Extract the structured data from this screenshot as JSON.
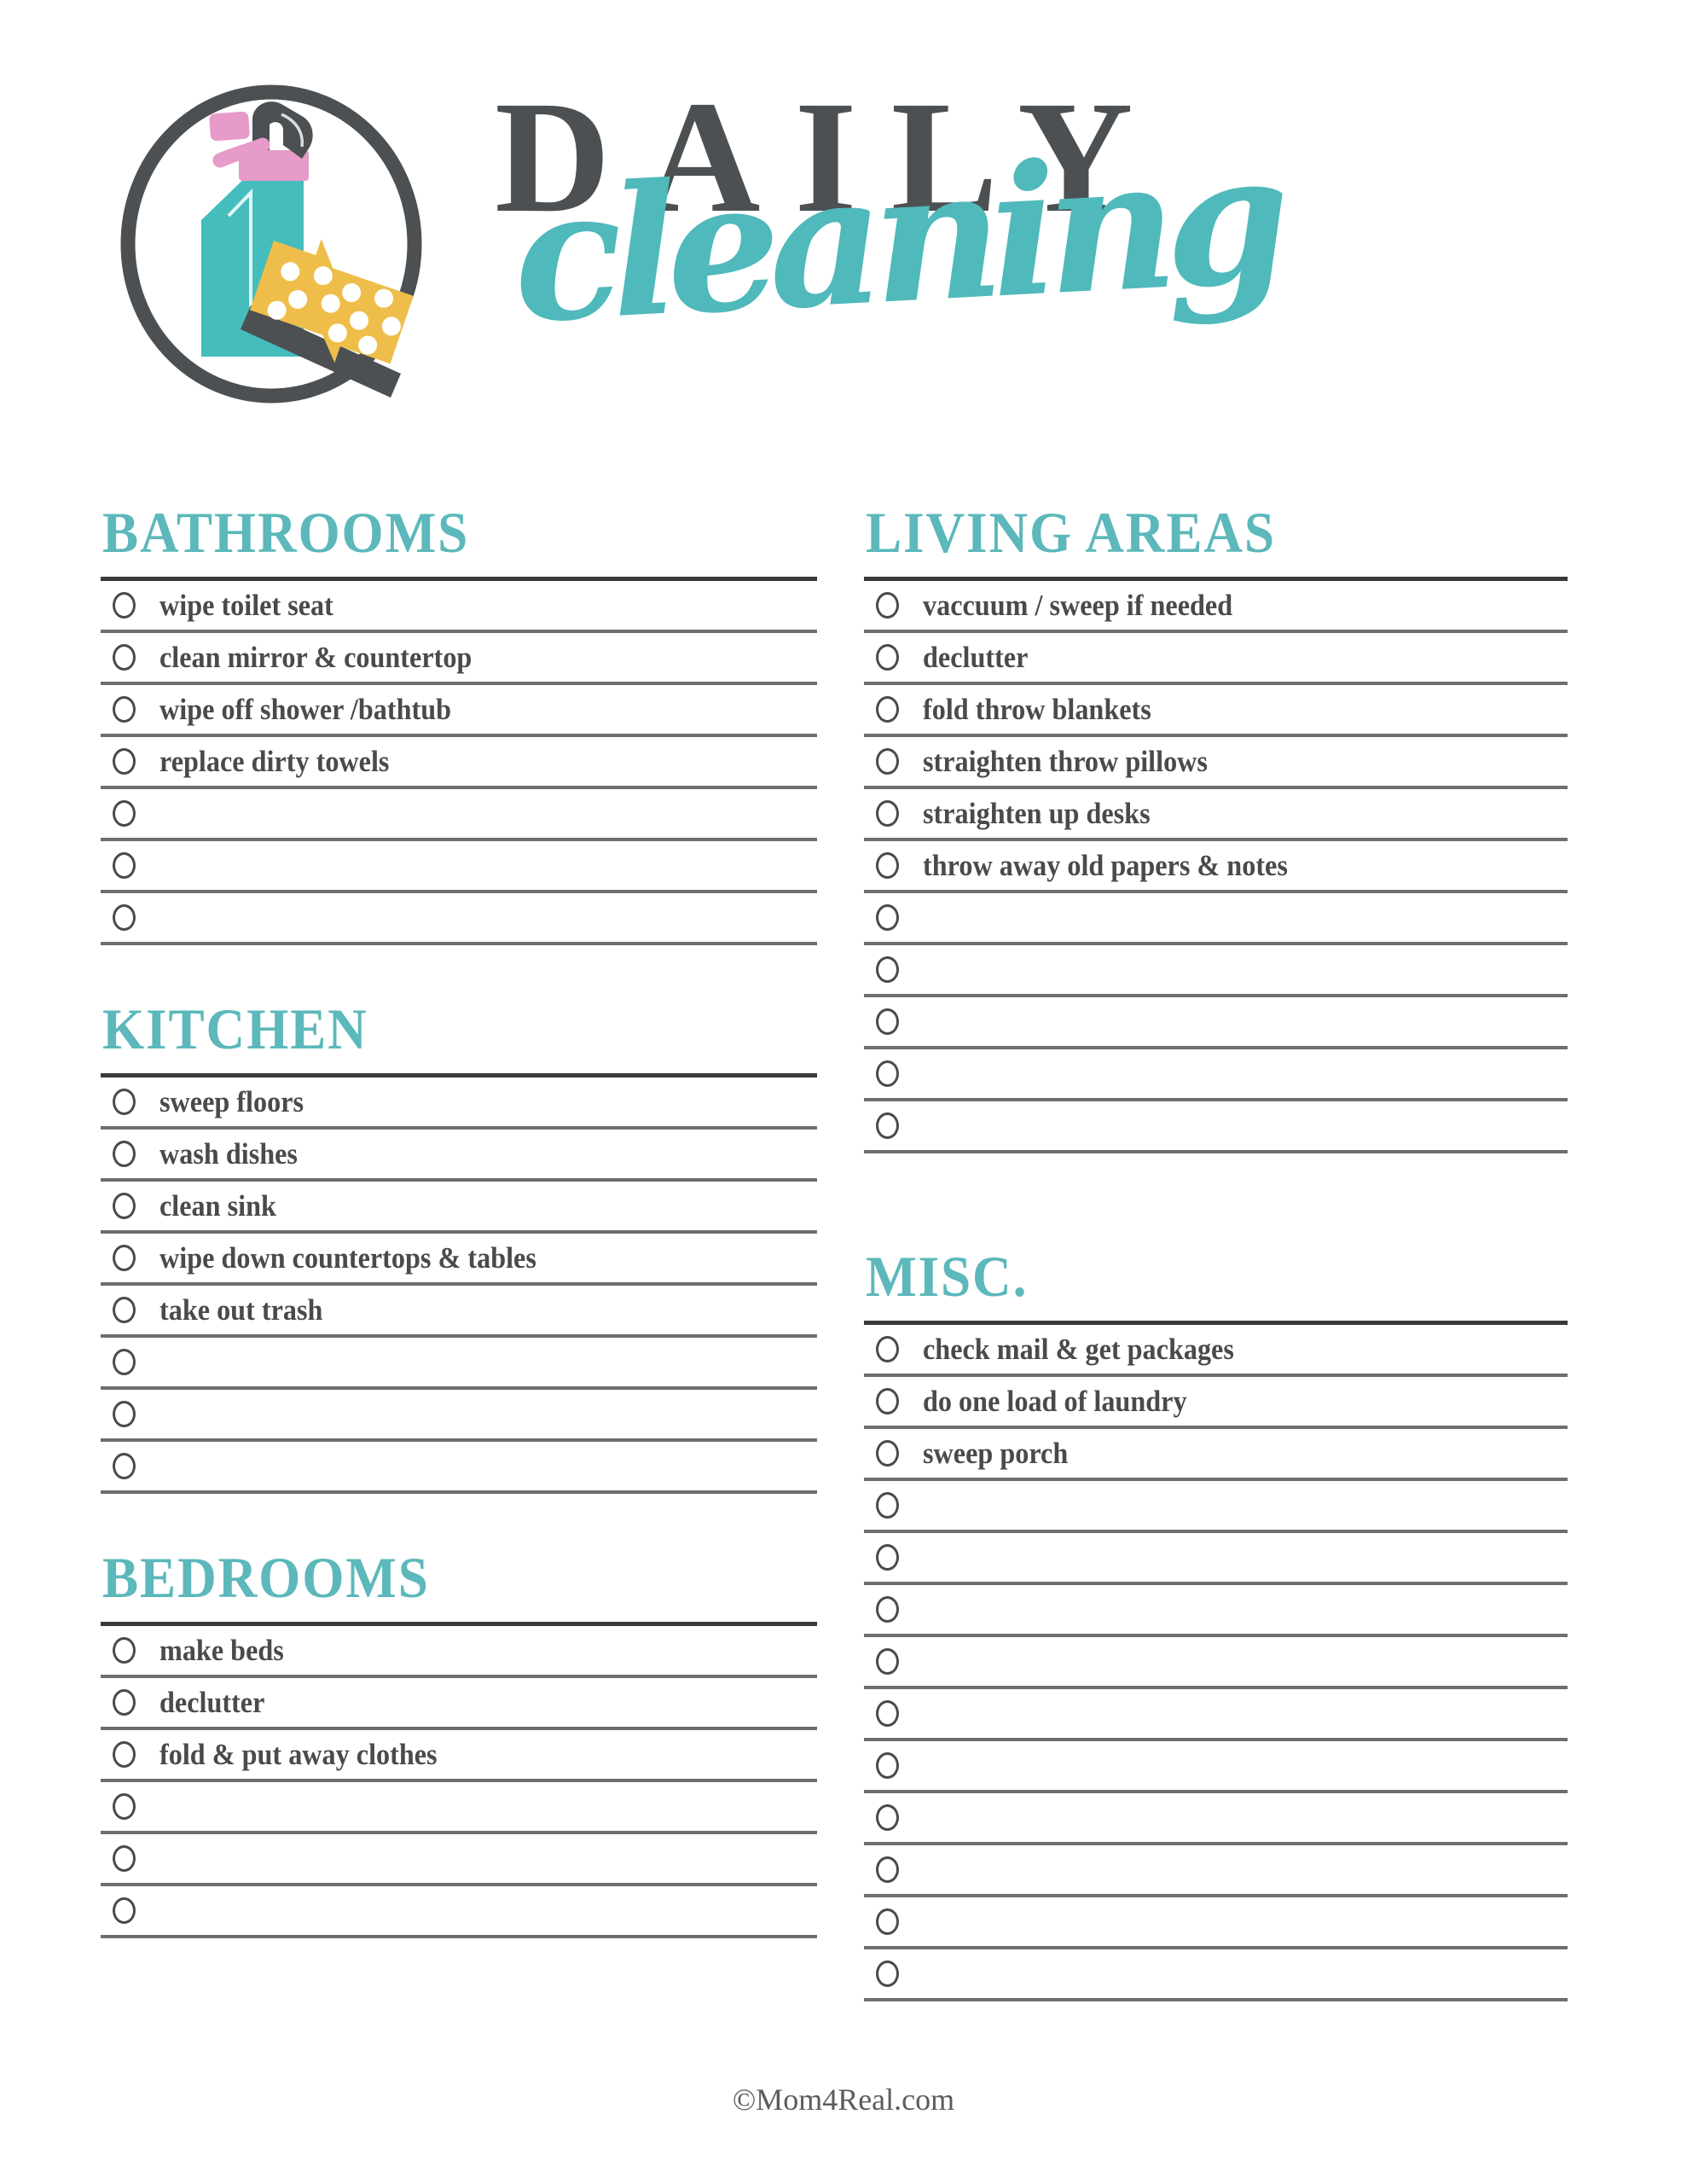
{
  "header": {
    "title_line1": "DAILY",
    "title_line2": "cleaning",
    "logo_icon": "spray-bottle-and-sponge-icon"
  },
  "colors": {
    "teal": "#5cb8ba",
    "bottle_teal": "#45bdbd",
    "pink": "#e69bc8",
    "yellow": "#efbe4a",
    "dark_gray": "#4c5052",
    "text_gray": "#4a4a4a",
    "rule_gray": "#6e6e6e",
    "header_rule": "#3a3a3a"
  },
  "columns": {
    "left": [
      {
        "title": "BATHROOMS",
        "items": [
          "wipe toilet seat",
          "clean mirror & countertop",
          "wipe off shower /bathtub",
          "replace dirty towels"
        ],
        "blank_rows": 3
      },
      {
        "title": "KITCHEN",
        "items": [
          "sweep floors",
          "wash dishes",
          "clean sink",
          "wipe down countertops & tables",
          "take out trash"
        ],
        "blank_rows": 3
      },
      {
        "title": "BEDROOMS",
        "items": [
          "make beds",
          "declutter",
          "fold & put away clothes"
        ],
        "blank_rows": 3
      }
    ],
    "right": [
      {
        "title": "LIVING AREAS",
        "items": [
          "vaccuum / sweep if needed",
          "declutter",
          "fold throw blankets",
          "straighten throw pillows",
          "straighten up desks",
          "throw away old papers & notes"
        ],
        "blank_rows": 5
      },
      {
        "title": "MISC.",
        "items": [
          "check mail & get packages",
          "do one load of laundry",
          "sweep porch"
        ],
        "blank_rows": 10
      }
    ]
  },
  "footer": {
    "copyright": "©Mom4Real.com"
  }
}
